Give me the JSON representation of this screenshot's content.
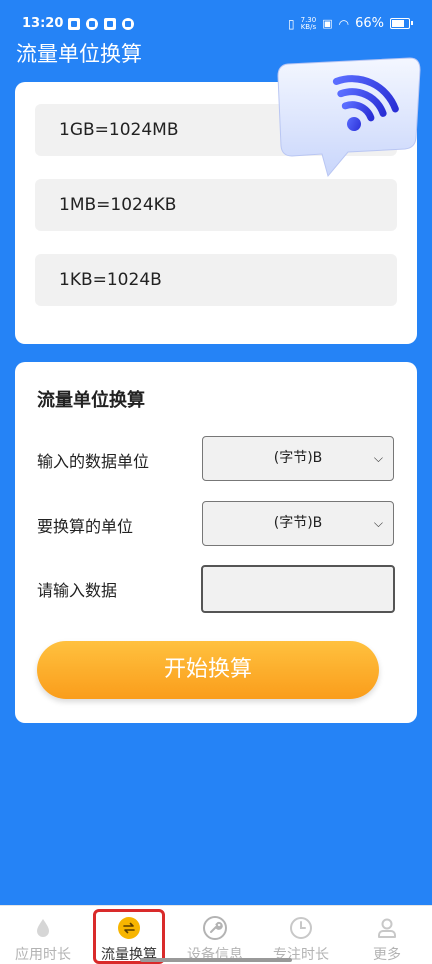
{
  "status_bar": {
    "time": "13:20",
    "net_speed_value": "7.30",
    "net_speed_unit": "KB/s",
    "battery": "66%"
  },
  "app": {
    "title": "流量单位换算"
  },
  "rules": [
    "1GB=1024MB",
    "1MB=1024KB",
    "1KB=1024B"
  ],
  "form": {
    "title": "流量单位换算",
    "input_unit_label": "输入的数据单位",
    "input_unit_value": "(字节)B",
    "target_unit_label": "要换算的单位",
    "target_unit_value": "(字节)B",
    "data_label": "请输入数据",
    "data_value": "",
    "start_button": "开始换算"
  },
  "nav": [
    {
      "label": "应用时长",
      "icon": "drop-icon",
      "active": false
    },
    {
      "label": "流量换算",
      "icon": "swap-icon",
      "active": true
    },
    {
      "label": "设备信息",
      "icon": "wrench-icon",
      "active": false
    },
    {
      "label": "专注时长",
      "icon": "clock-icon",
      "active": false
    },
    {
      "label": "更多",
      "icon": "person-icon",
      "active": false
    }
  ],
  "colors": {
    "background": "#2583f6",
    "button_orange": "#fa9d1b",
    "highlight_red": "#d92a2a"
  }
}
